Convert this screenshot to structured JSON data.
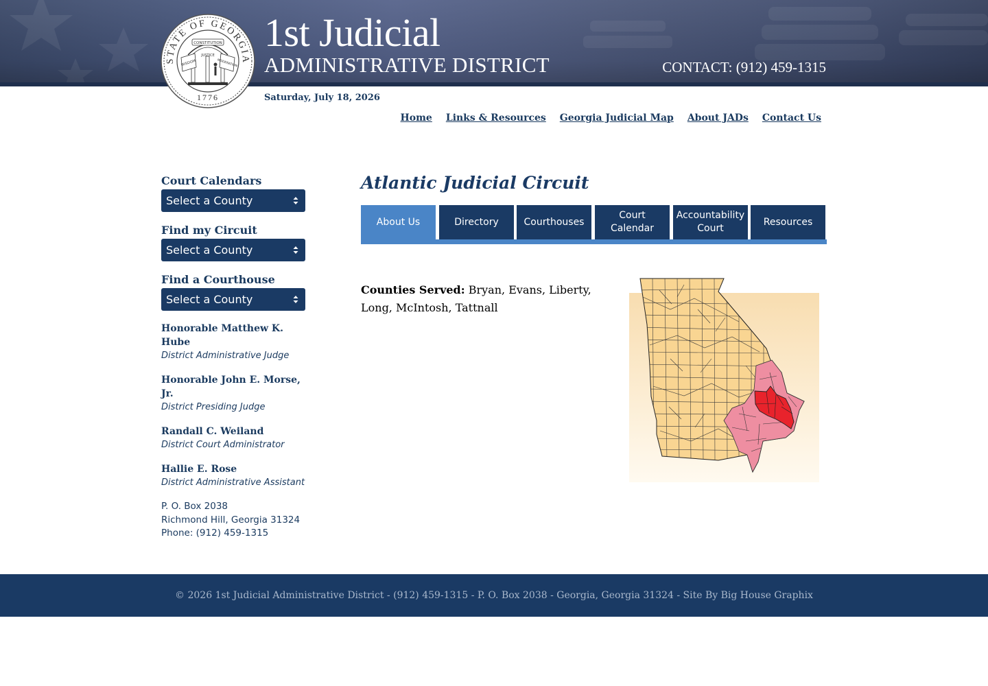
{
  "header": {
    "title_line1": "1st Judicial",
    "title_line2": "ADMINISTRATIVE DISTRICT",
    "contact": "CONTACT: (912) 459-1315",
    "date": "Saturday, July 18, 2026",
    "seal": {
      "top_text": "STATE OF GEORGIA",
      "banner_text": "CONSTITUTION",
      "left_text": "WISDOM",
      "middle_text": "JUSTICE",
      "right_text": "MODERATION",
      "year": "1776"
    }
  },
  "nav": {
    "items": [
      {
        "label": "Home"
      },
      {
        "label": "Links & Resources"
      },
      {
        "label": "Georgia Judicial Map"
      },
      {
        "label": "About JADs"
      },
      {
        "label": "Contact Us"
      }
    ]
  },
  "sidebar": {
    "court_calendars": {
      "heading": "Court Calendars",
      "select": "Select a County"
    },
    "find_circuit": {
      "heading": "Find my Circuit",
      "select": "Select a County"
    },
    "find_courthouse": {
      "heading": "Find a Courthouse",
      "select": "Select a County"
    },
    "people": [
      {
        "name": "Honorable Matthew K. Hube",
        "title": "District Administrative Judge"
      },
      {
        "name": "Honorable John E. Morse, Jr.",
        "title": "District Presiding Judge"
      },
      {
        "name": "Randall C. Weiland",
        "title": "District Court Administrator"
      },
      {
        "name": "Hallie E. Rose",
        "title": "District Administrative Assistant"
      }
    ],
    "address": {
      "line1": "P. O. Box 2038",
      "line2": "Richmond Hill, Georgia 31324",
      "phone": "Phone: (912) 459-1315"
    }
  },
  "main": {
    "circuit_title": "Atlantic Judicial Circuit",
    "tabs": [
      {
        "label": "About Us",
        "active": true
      },
      {
        "label": "Directory"
      },
      {
        "label": "Courthouses"
      },
      {
        "label": "Court Calendar"
      },
      {
        "label": "Accountability Court"
      },
      {
        "label": "Resources"
      }
    ],
    "counties_label": "Counties Served:",
    "counties_value": "Bryan, Evans, Liberty, Long, McIntosh, Tattnall"
  },
  "footer": {
    "text": "© 2026 1st Judicial Administrative District - (912) 459-1315 - P. O. Box 2038 - Georgia, Georgia 31324 - Site By Big House Graphix"
  },
  "colors": {
    "navy": "#1a3a64",
    "tab_active": "#4a85c7",
    "map_state": "#f9d592",
    "map_district": "#ee8ea1",
    "map_circuit": "#e8232c"
  }
}
